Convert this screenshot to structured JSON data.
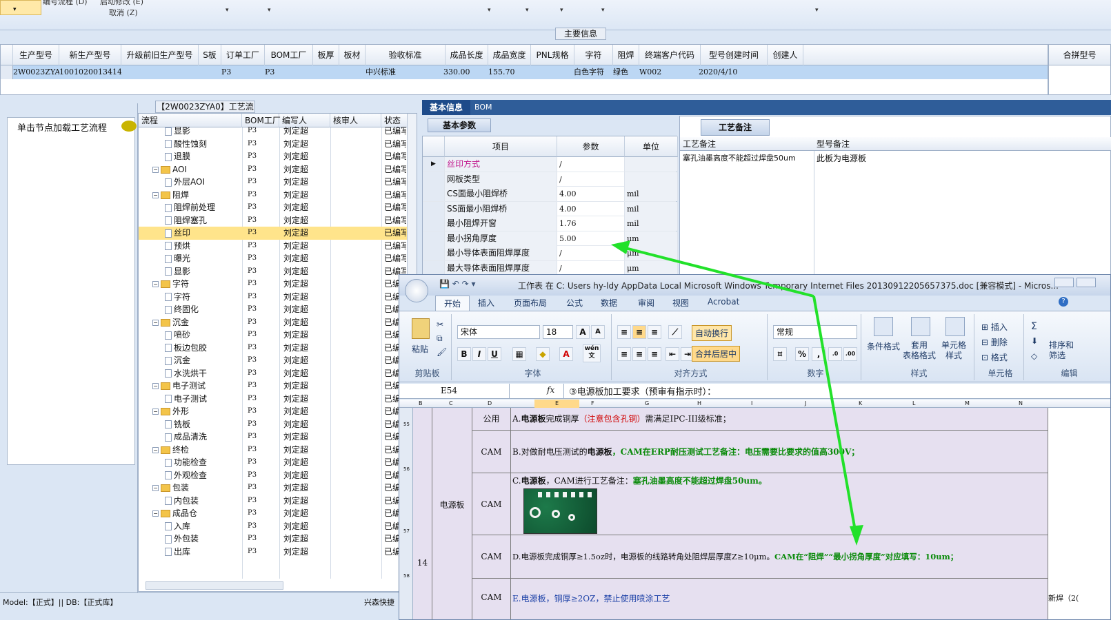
{
  "topbar": {
    "item1": "编号流程 (D)",
    "item2": "启动修改 (E)",
    "item3": "取消 (Z)"
  },
  "main_info": {
    "title": "主要信息",
    "columns": [
      "生产型号",
      "新生产型号",
      "升级前旧生产型号",
      "S板",
      "订单工厂",
      "BOM工厂",
      "板厚",
      "板材",
      "验收标准",
      "成品长度",
      "成品宽度",
      "PNL规格",
      "字符",
      "阻焊",
      "终端客户代码",
      "型号创建时间",
      "创建人"
    ],
    "row": {
      "生产型号": "2W0023ZYA0",
      "新生产型号": "10010200134142",
      "订单工厂": "P3",
      "BOM工厂": "P3",
      "验收标准": "中兴标准",
      "成品长度": "330.00",
      "成品宽度": "155.70",
      "字符": "白色字符",
      "阻焊": "绿色",
      "终端客户代码": "W002",
      "型号创建时间": "2020/4/10"
    },
    "merge_label": "合拼型号"
  },
  "left_panel": {
    "load_label": "单击节点加载工艺流程"
  },
  "tree": {
    "title": "【2W0023ZYA0】工艺流程",
    "headers": [
      "流程",
      "BOM工厂",
      "编写人",
      "核审人",
      "状态"
    ],
    "rows": [
      {
        "name": "显影",
        "type": "doc",
        "bom": "P3",
        "writer": "刘定超",
        "status": "已编写"
      },
      {
        "name": "酸性蚀刻",
        "type": "doc",
        "bom": "P3",
        "writer": "刘定超",
        "status": "已编写"
      },
      {
        "name": "退膜",
        "type": "doc",
        "bom": "P3",
        "writer": "刘定超",
        "status": "已编写"
      },
      {
        "name": "AOI",
        "type": "folder",
        "bom": "P3",
        "writer": "刘定超",
        "status": "已编写"
      },
      {
        "name": "外层AOI",
        "type": "doc",
        "bom": "P3",
        "writer": "刘定超",
        "status": "已编写"
      },
      {
        "name": "阻焊",
        "type": "folder",
        "bom": "P3",
        "writer": "刘定超",
        "status": "已编写"
      },
      {
        "name": "阻焊前处理",
        "type": "doc",
        "bom": "P3",
        "writer": "刘定超",
        "status": "已编写"
      },
      {
        "name": "阻焊塞孔",
        "type": "doc",
        "bom": "P3",
        "writer": "刘定超",
        "status": "已编写"
      },
      {
        "name": "丝印",
        "type": "doc",
        "bom": "P3",
        "writer": "刘定超",
        "status": "已编写",
        "selected": true
      },
      {
        "name": "预烘",
        "type": "doc",
        "bom": "P3",
        "writer": "刘定超",
        "status": "已编写"
      },
      {
        "name": "曝光",
        "type": "doc",
        "bom": "P3",
        "writer": "刘定超",
        "status": "已编写"
      },
      {
        "name": "显影",
        "type": "doc",
        "bom": "P3",
        "writer": "刘定超",
        "status": "已编写"
      },
      {
        "name": "字符",
        "type": "folder",
        "bom": "P3",
        "writer": "刘定超",
        "status": "已编写"
      },
      {
        "name": "字符",
        "type": "doc",
        "bom": "P3",
        "writer": "刘定超",
        "status": "已编写"
      },
      {
        "name": "终固化",
        "type": "doc",
        "bom": "P3",
        "writer": "刘定超",
        "status": "已编写"
      },
      {
        "name": "沉金",
        "type": "folder",
        "bom": "P3",
        "writer": "刘定超",
        "status": "已编写"
      },
      {
        "name": "喷砂",
        "type": "doc",
        "bom": "P3",
        "writer": "刘定超",
        "status": "已编写"
      },
      {
        "name": "板边包胶",
        "type": "doc",
        "bom": "P3",
        "writer": "刘定超",
        "status": "已编写"
      },
      {
        "name": "沉金",
        "type": "doc",
        "bom": "P3",
        "writer": "刘定超",
        "status": "已编写"
      },
      {
        "name": "水洗烘干",
        "type": "doc",
        "bom": "P3",
        "writer": "刘定超",
        "status": "已编写"
      },
      {
        "name": "电子测试",
        "type": "folder",
        "bom": "P3",
        "writer": "刘定超",
        "status": "已编写"
      },
      {
        "name": "电子测试",
        "type": "doc",
        "bom": "P3",
        "writer": "刘定超",
        "status": "已编写"
      },
      {
        "name": "外形",
        "type": "folder",
        "bom": "P3",
        "writer": "刘定超",
        "status": "已编写"
      },
      {
        "name": "铣板",
        "type": "doc",
        "bom": "P3",
        "writer": "刘定超",
        "status": "已编写"
      },
      {
        "name": "成品清洗",
        "type": "doc",
        "bom": "P3",
        "writer": "刘定超",
        "status": "已编写"
      },
      {
        "name": "终检",
        "type": "folder",
        "bom": "P3",
        "writer": "刘定超",
        "status": "已编写"
      },
      {
        "name": "功能检查",
        "type": "doc",
        "bom": "P3",
        "writer": "刘定超",
        "status": "已编写"
      },
      {
        "name": "外观检查",
        "type": "doc",
        "bom": "P3",
        "writer": "刘定超",
        "status": "已编写"
      },
      {
        "name": "包装",
        "type": "folder",
        "bom": "P3",
        "writer": "刘定超",
        "status": "已编写"
      },
      {
        "name": "内包装",
        "type": "doc",
        "bom": "P3",
        "writer": "刘定超",
        "status": "已编写"
      },
      {
        "name": "成品仓",
        "type": "folder",
        "bom": "P3",
        "writer": "刘定超",
        "status": "已编写"
      },
      {
        "name": "入库",
        "type": "doc",
        "bom": "P3",
        "writer": "刘定超",
        "status": "已编写"
      },
      {
        "name": "外包装",
        "type": "doc",
        "bom": "P3",
        "writer": "刘定超",
        "status": "已编写"
      },
      {
        "name": "出库",
        "type": "doc",
        "bom": "P3",
        "writer": "刘定超",
        "status": "已编写"
      }
    ]
  },
  "basic_info": {
    "tab_basic": "基本信息",
    "tab_bom": "BOM",
    "subtab": "基本参数",
    "headers": [
      "项目",
      "参数",
      "单位"
    ],
    "rows": [
      {
        "item": "丝印方式",
        "value": "/",
        "unit": ""
      },
      {
        "item": "网板类型",
        "value": "/",
        "unit": ""
      },
      {
        "item": "CS面最小阻焊桥",
        "value": "4.00",
        "unit": "mil"
      },
      {
        "item": "SS面最小阻焊桥",
        "value": "4.00",
        "unit": "mil"
      },
      {
        "item": "最小阻焊开窗",
        "value": "1.76",
        "unit": "mil"
      },
      {
        "item": "最小拐角厚度",
        "value": "5.00",
        "unit": "μm"
      },
      {
        "item": "最小导体表面阻焊厚度",
        "value": "/",
        "unit": "μm"
      },
      {
        "item": "最大导体表面阻焊厚度",
        "value": "/",
        "unit": "μm"
      }
    ]
  },
  "craft_notes": {
    "tab": "工艺备注",
    "h1": "工艺备注",
    "h2": "型号备注",
    "v1": "塞孔油墨高度不能超过焊盘50um",
    "v2": "此板为电源板"
  },
  "status": {
    "left": "Model:【正式】|| DB:【正式库】",
    "right": "兴森快捷"
  },
  "excel": {
    "title": "工作表 在 C: Users hy-ldy AppData Local Microsoft Windows Temporary Internet Files 20130912205657375.doc [兼容模式] - Micros...",
    "tabs": [
      "开始",
      "插入",
      "页面布局",
      "公式",
      "数据",
      "审阅",
      "视图",
      "Acrobat"
    ],
    "paste": "粘贴",
    "clipboard": "剪贴板",
    "font_name": "宋体",
    "font_size": "18",
    "font_group": "字体",
    "wrap": "自动换行",
    "merge_center": "合并后居中",
    "align_group": "对齐方式",
    "number_format": "常规",
    "number_group": "数字",
    "cond_format": "条件格式",
    "table_format": "套用\n表格格式",
    "cell_style": "单元格\n样式",
    "styles_group": "样式",
    "insert": "插入",
    "delete": "删除",
    "format": "格式",
    "cells_group": "单元格",
    "sort_filter": "排序和\n筛选",
    "edit_group": "编辑",
    "bold": "B",
    "italic": "I",
    "underline": "U",
    "grow_font": "A",
    "phonetic": "wén\n文",
    "fx": "fx",
    "name_box": "E54",
    "formula": "③电源板加工要求（预审有指示时）：",
    "col_headers": [
      "B",
      "C",
      "D",
      "E",
      "F",
      "G",
      "H",
      "I",
      "J",
      "K",
      "L",
      "M",
      "N"
    ],
    "row_nums": [
      "55",
      "56",
      "57",
      "58"
    ],
    "row_number": "14",
    "category": "电源板",
    "rows": [
      {
        "who": "公用",
        "a_pre": "A.",
        "a_b": "电源板",
        "a_mid": "完成铜厚",
        "a_red": "（注意包含孔铜）",
        "a_post": "需满足IPC-III级标准；"
      },
      {
        "who": "CAM",
        "b_pre": "B.对做耐电压测试的",
        "b_b": "电源板",
        "b_post": "，CAM在ERP耐压测试工艺备注：电压需要比要求的值高300V；"
      },
      {
        "who": "CAM",
        "c_pre": "C.",
        "c_b": "电源板",
        "c_mid": "，CAM进行工艺备注：",
        "c_green": "塞孔油墨高度不能超过焊盘50um。"
      },
      {
        "who": "CAM",
        "d_pre": "D.电源板完成铜厚≥1.5oz时，电源板的线路转角处阻焊层厚度Z≥10μm。",
        "d_green": "CAM在“阻焊”“最小拐角厚度”对应填写：10um；"
      },
      {
        "who": "CAM",
        "e_text": "E.电源板，铜厚≥2OZ，禁止使用喷涂工艺"
      }
    ],
    "side_note": "新焊（2("
  },
  "colors": {
    "arrow": "#22e12a",
    "selected_row": "#ffe48b",
    "grid_row": "#bcd7f4"
  }
}
